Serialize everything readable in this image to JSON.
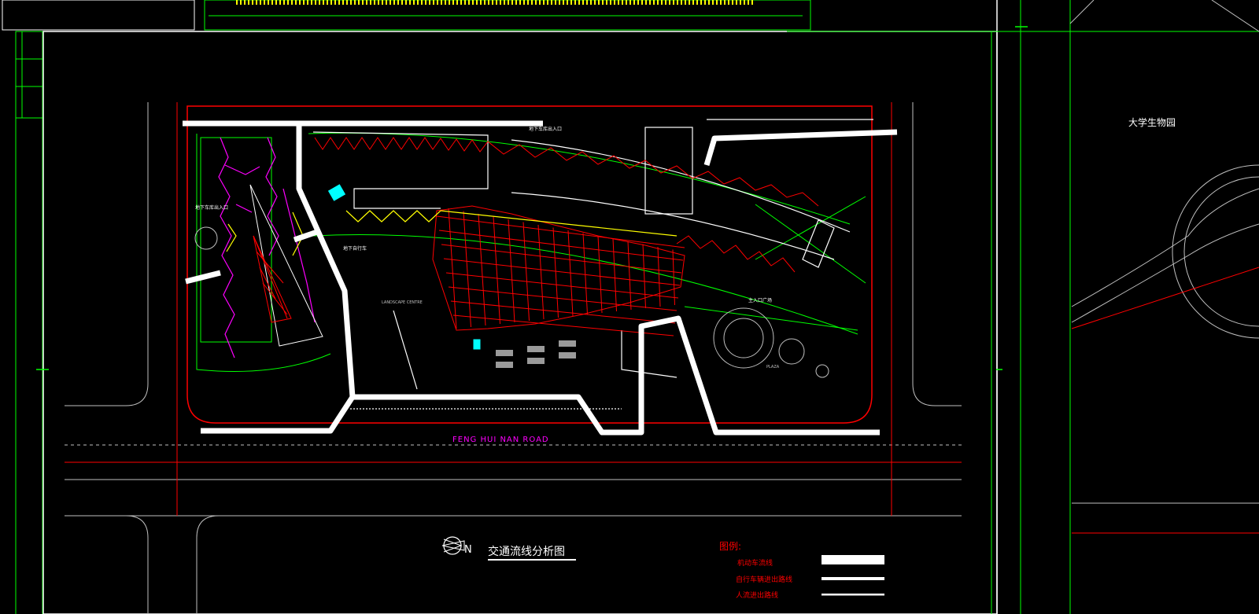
{
  "drawing": {
    "title": "交通流线分析图",
    "road_name": "FENG HUI NAN ROAD",
    "side_title": "大学生物园",
    "north_label": "N",
    "legend": {
      "heading": "图例:",
      "items": [
        {
          "label": "机动车流线",
          "style": "thick"
        },
        {
          "label": "自行车辆进出路线",
          "style": "medium"
        },
        {
          "label": "人流进出路线",
          "style": "thin"
        }
      ]
    },
    "plan_labels": {
      "motor_entry": "地下车库出入口",
      "main_entry": "地下车库出入口",
      "bike": "地下自行车",
      "plaza": "PLAZA",
      "landscape": "LANDSCAPE CENTRE",
      "axis": "主入口广场"
    }
  },
  "colors": {
    "background": "#000000",
    "frame": "#ffffff",
    "cad_green": "#00ff00",
    "cad_red": "#ff0000",
    "magenta": "#ff00ff",
    "yellow": "#ffff00",
    "cyan": "#00ffff",
    "grey": "#c0c0c0"
  }
}
